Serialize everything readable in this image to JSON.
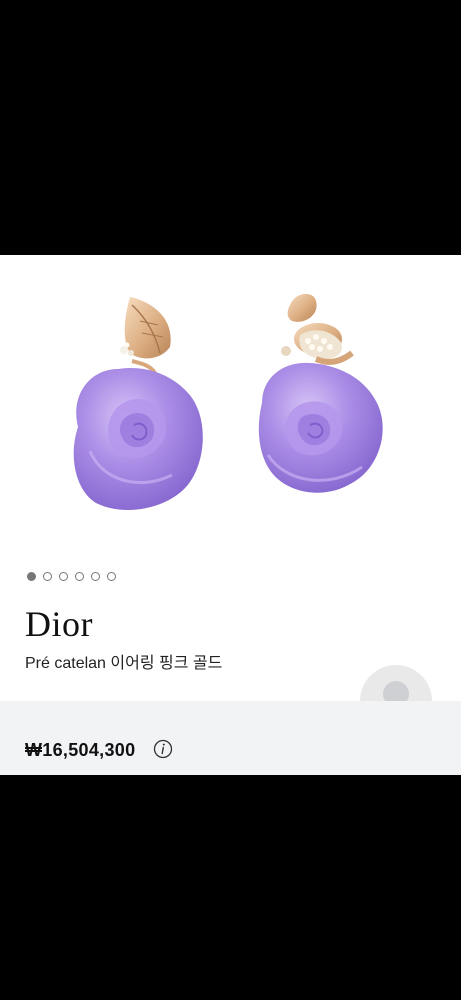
{
  "product": {
    "brand": "Dior",
    "name": "Pré catelan 이어링 핑크 골드",
    "price": "₩16,504,300"
  },
  "gallery": {
    "image_count": 6,
    "active_index": 0
  },
  "colors": {
    "page_background": "#000000",
    "card_background": "#ffffff",
    "price_bar_background": "#f2f3f5",
    "amethyst": "#a98ae6",
    "rose_gold": "#e4b98c"
  },
  "icons": {
    "info": "info-icon",
    "avatar": "user-avatar-placeholder-icon"
  }
}
